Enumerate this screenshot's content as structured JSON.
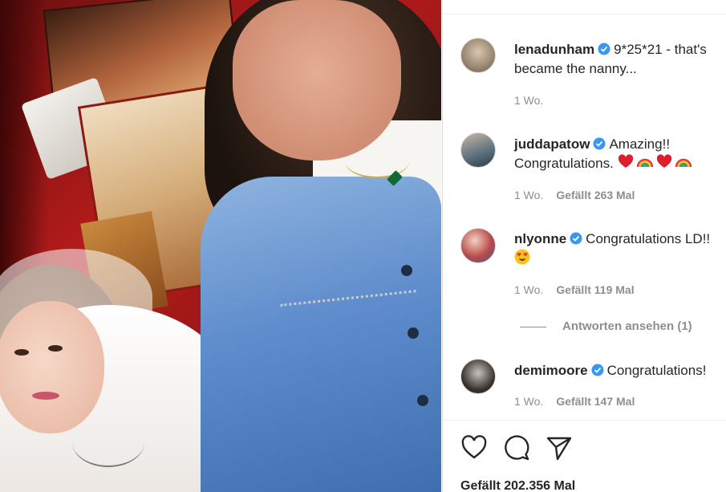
{
  "post": {
    "comments": [
      {
        "username": "lenadunham",
        "verified": true,
        "text": "9*25*21 - that's became the nanny...",
        "time": "1 Wo.",
        "likes": ""
      },
      {
        "username": "juddapatow",
        "verified": true,
        "text": "Amazing!! Congratulations.",
        "emojis": [
          "heart",
          "rainbow",
          "heart",
          "rainbow"
        ],
        "time": "1 Wo.",
        "likes": "Gefällt 263 Mal"
      },
      {
        "username": "nlyonne",
        "verified": true,
        "text": "Congratulations LD!!",
        "emojis": [
          "heart-eyes"
        ],
        "time": "1 Wo.",
        "likes": "Gefällt 119 Mal"
      },
      {
        "username": "demimoore",
        "verified": true,
        "text": "Congratulations!",
        "time": "1 Wo.",
        "likes": "Gefällt 147 Mal"
      }
    ],
    "view_replies": "Antworten ansehen (1)",
    "actions": {
      "like_icon": "heart-outline-icon",
      "comment_icon": "comment-bubble-icon",
      "share_icon": "paper-plane-icon"
    },
    "like_count": "Gefällt 202.356 Mal"
  },
  "colors": {
    "verified_blue": "#3897f0",
    "text": "#262626",
    "muted": "#8e8e8e"
  }
}
